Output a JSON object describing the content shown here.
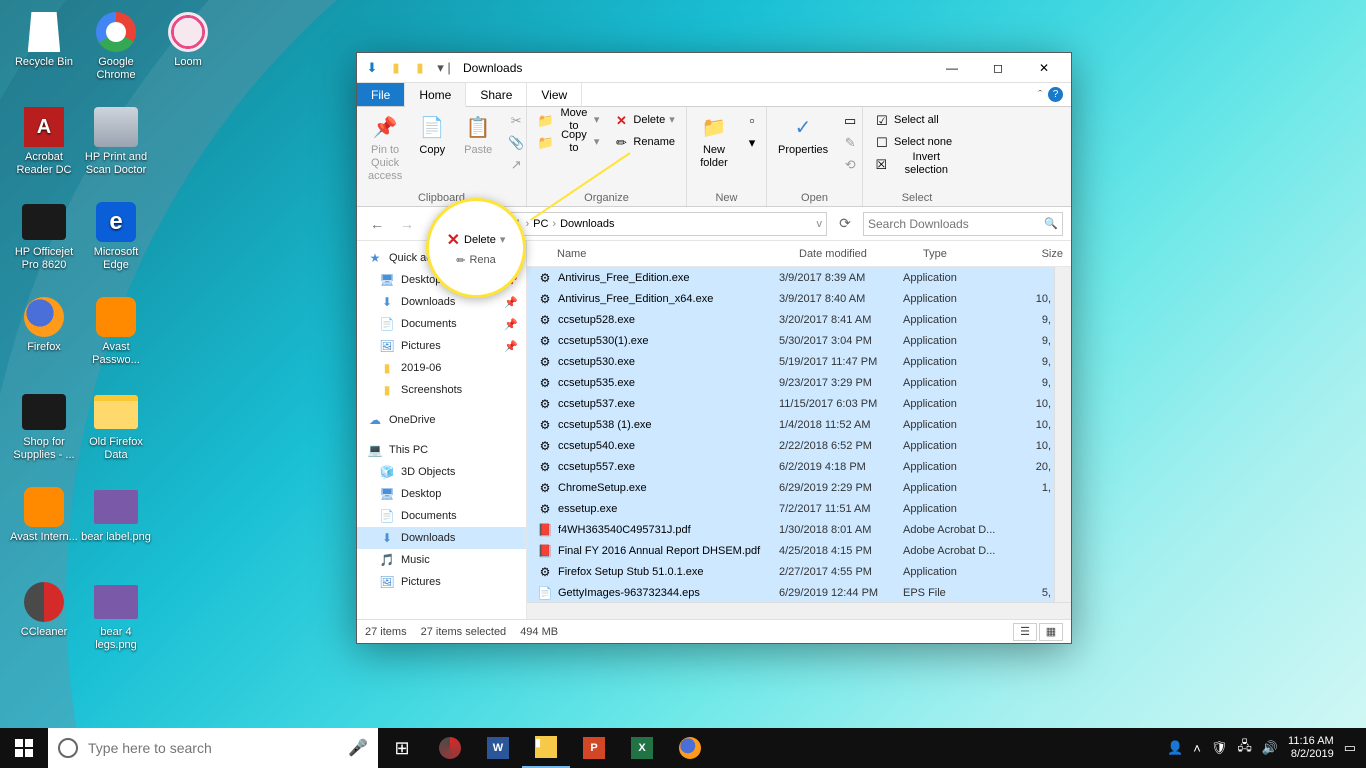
{
  "desktop": {
    "icons": [
      {
        "label": "Recycle Bin",
        "kind": "recycle"
      },
      {
        "label": "Google Chrome",
        "kind": "chrome"
      },
      {
        "label": "Loom",
        "kind": "loom"
      },
      {
        "label": "Acrobat Reader DC",
        "kind": "adobe",
        "glyph": "A"
      },
      {
        "label": "HP Print and Scan Doctor",
        "kind": "hp"
      },
      {
        "label": ""
      },
      {
        "label": "HP Officejet Pro 8620",
        "kind": "printerico"
      },
      {
        "label": "Microsoft Edge",
        "kind": "edge",
        "glyph": "e"
      },
      {
        "label": ""
      },
      {
        "label": "Firefox",
        "kind": "ffx"
      },
      {
        "label": "Avast Passwo...",
        "kind": "avast"
      },
      {
        "label": ""
      },
      {
        "label": "Shop for Supplies - ...",
        "kind": "printerico"
      },
      {
        "label": "Old Firefox Data",
        "kind": "folder"
      },
      {
        "label": ""
      },
      {
        "label": "Avast Intern...",
        "kind": "avast"
      },
      {
        "label": "bear label.png",
        "kind": "thumb"
      },
      {
        "label": ""
      },
      {
        "label": "CCleaner",
        "kind": "cclean"
      },
      {
        "label": "bear 4 legs.png",
        "kind": "thumb"
      },
      {
        "label": ""
      }
    ]
  },
  "window": {
    "title": "Downloads",
    "tabs": {
      "file": "File",
      "home": "Home",
      "share": "Share",
      "view": "View"
    },
    "ribbon": {
      "clipboard": {
        "name": "Clipboard",
        "pin": "Pin to Quick access",
        "copy": "Copy",
        "paste": "Paste"
      },
      "organize": {
        "name": "Organize",
        "moveto": "Move to",
        "copyto": "Copy to",
        "delete": "Delete",
        "rename": "Rename"
      },
      "new": {
        "name": "New",
        "newfolder": "New folder"
      },
      "open": {
        "name": "Open",
        "properties": "Properties"
      },
      "select": {
        "name": "Select",
        "all": "Select all",
        "none": "Select none",
        "invert": "Invert selection"
      }
    },
    "crumb": {
      "root": "PC",
      "folder": "Downloads",
      "chev": "›"
    },
    "search_placeholder": "Search Downloads",
    "side": {
      "quick": "Quick access",
      "desktop": "Desktop",
      "downloads": "Downloads",
      "documents": "Documents",
      "pictures": "Pictures",
      "y2019": "2019-06",
      "screenshots": "Screenshots",
      "onedrive": "OneDrive",
      "thispc": "This PC",
      "threed": "3D Objects",
      "desk2": "Desktop",
      "docs2": "Documents",
      "dl2": "Downloads",
      "music": "Music",
      "pics2": "Pictures"
    },
    "cols": {
      "name": "Name",
      "date": "Date modified",
      "type": "Type",
      "size": "Size"
    },
    "files": [
      {
        "n": "Antivirus_Free_Edition.exe",
        "d": "3/9/2017 8:39 AM",
        "t": "Application",
        "s": ""
      },
      {
        "n": "Antivirus_Free_Edition_x64.exe",
        "d": "3/9/2017 8:40 AM",
        "t": "Application",
        "s": "10,"
      },
      {
        "n": "ccsetup528.exe",
        "d": "3/20/2017 8:41 AM",
        "t": "Application",
        "s": "9,"
      },
      {
        "n": "ccsetup530(1).exe",
        "d": "5/30/2017 3:04 PM",
        "t": "Application",
        "s": "9,"
      },
      {
        "n": "ccsetup530.exe",
        "d": "5/19/2017 11:47 PM",
        "t": "Application",
        "s": "9,"
      },
      {
        "n": "ccsetup535.exe",
        "d": "9/23/2017 3:29 PM",
        "t": "Application",
        "s": "9,"
      },
      {
        "n": "ccsetup537.exe",
        "d": "11/15/2017 6:03 PM",
        "t": "Application",
        "s": "10,"
      },
      {
        "n": "ccsetup538 (1).exe",
        "d": "1/4/2018 11:52 AM",
        "t": "Application",
        "s": "10,"
      },
      {
        "n": "ccsetup540.exe",
        "d": "2/22/2018 6:52 PM",
        "t": "Application",
        "s": "10,"
      },
      {
        "n": "ccsetup557.exe",
        "d": "6/2/2019 4:18 PM",
        "t": "Application",
        "s": "20,"
      },
      {
        "n": "ChromeSetup.exe",
        "d": "6/29/2019 2:29 PM",
        "t": "Application",
        "s": "1,"
      },
      {
        "n": "essetup.exe",
        "d": "7/2/2017 11:51 AM",
        "t": "Application",
        "s": ""
      },
      {
        "n": "f4WH363540C495731J.pdf",
        "d": "1/30/2018 8:01 AM",
        "t": "Adobe Acrobat D...",
        "s": ""
      },
      {
        "n": "Final FY 2016 Annual Report DHSEM.pdf",
        "d": "4/25/2018 4:15 PM",
        "t": "Adobe Acrobat D...",
        "s": ""
      },
      {
        "n": "Firefox Setup Stub 51.0.1.exe",
        "d": "2/27/2017 4:55 PM",
        "t": "Application",
        "s": ""
      },
      {
        "n": "GettyImages-963732344.eps",
        "d": "6/29/2019 12:44 PM",
        "t": "EPS File",
        "s": "5,"
      }
    ],
    "status": {
      "items": "27 items",
      "selected": "27 items selected",
      "size": "494 MB"
    }
  },
  "callout": {
    "delete": "Delete",
    "rename": "Rena"
  },
  "taskbar": {
    "search_placeholder": "Type here to search",
    "time": "11:16 AM",
    "date": "8/2/2019"
  }
}
